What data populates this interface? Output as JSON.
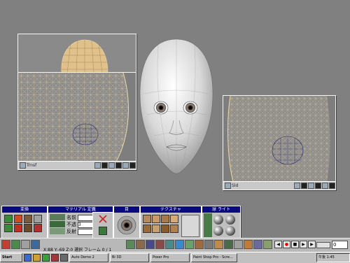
{
  "viewport_left": {
    "tab_label": "Trnsf"
  },
  "viewport_right": {
    "tab_label": "Sld"
  },
  "panels": {
    "transform": {
      "title": "変換"
    },
    "material": {
      "title": "マテリアル 定義"
    },
    "fields": [
      {
        "label": "名前",
        "value": ""
      },
      {
        "label": "不透",
        "value": "3"
      },
      {
        "label": "反射",
        "value": ""
      }
    ],
    "eye": {
      "title": "目"
    },
    "texture": {
      "title": "テクスチャ"
    },
    "sphere": {
      "title": "球 ライト"
    }
  },
  "status_text": "X:88 Y:-69 Z:0 選択 フレーム 0 / 1",
  "frame_value": "0",
  "taskbar": {
    "start_label": "Start",
    "items": [
      "Auto Demo 2",
      "Bi 3D",
      "Poser Pro",
      "Paint Shop Pro - Scre..."
    ],
    "clock": "午後 1:45"
  }
}
